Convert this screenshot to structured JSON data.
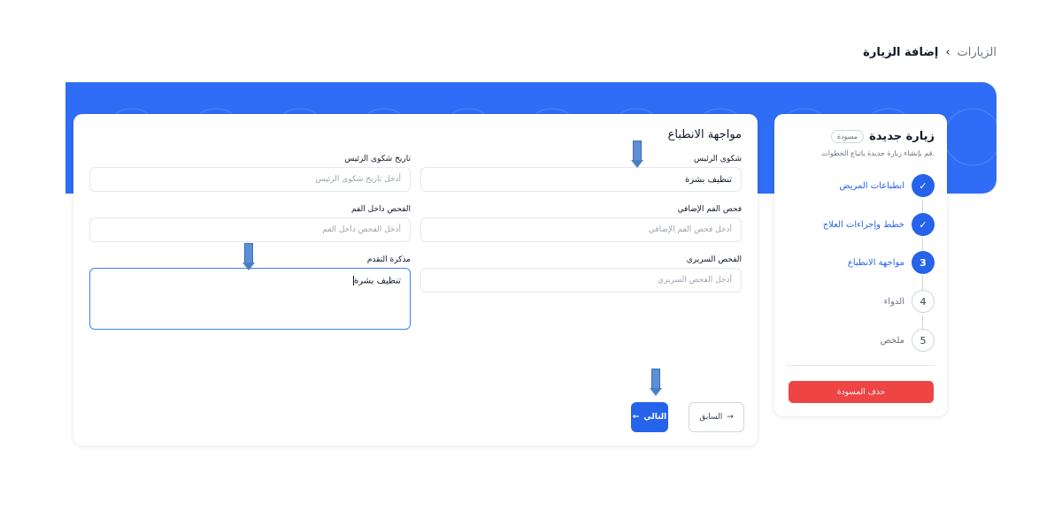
{
  "breadcrumb": {
    "parent": "الزيارات",
    "separator": "›",
    "current": "إضافة الزيارة"
  },
  "colors": {
    "accent": "#2563eb",
    "hero": "#2f6df6",
    "danger": "#ef4444"
  },
  "form": {
    "title": "مواجهة الانطباع",
    "fields": {
      "chief_complaint": {
        "label": "شكوى الرئيس",
        "value": "تنظيف بشرة",
        "placeholder": ""
      },
      "complaint_history": {
        "label": "تاريخ شكوى الرئيس",
        "value": "",
        "placeholder": "أدخل تاريخ شكوى الرئيس"
      },
      "extra_oral": {
        "label": "فحص الفم الإضافي",
        "value": "",
        "placeholder": "أدخل فحص الفم الإضافي"
      },
      "intra_oral": {
        "label": "الفحص داخل الفم",
        "value": "",
        "placeholder": "أدخل الفحص داخل الفم"
      },
      "clinical_exam": {
        "label": "الفحص السريري",
        "value": "",
        "placeholder": "أدخل الفحص السريري"
      },
      "progress_note": {
        "label": "مذكرة التقدم",
        "value": "تنظيف بشرة"
      }
    },
    "next_label": "التالي",
    "prev_label": "السابق",
    "icons": {
      "next": "arrow-left-icon",
      "prev": "arrow-right-icon"
    }
  },
  "stepper": {
    "title": "زيارة جديدة",
    "badge": "مسودة",
    "subtitle": ".قم بإنشاء زيارة جديدة باتباع الخطوات",
    "steps": [
      {
        "num": "✓",
        "label": "انطباعات المريض",
        "state": "done"
      },
      {
        "num": "✓",
        "label": "خطط وإجراءات العلاج",
        "state": "done"
      },
      {
        "num": "3",
        "label": "مواجهة الانطباع",
        "state": "current"
      },
      {
        "num": "4",
        "label": "الدواء",
        "state": "todo"
      },
      {
        "num": "5",
        "label": "ملخص",
        "state": "todo"
      }
    ],
    "delete_label": "حذف المسودة"
  }
}
